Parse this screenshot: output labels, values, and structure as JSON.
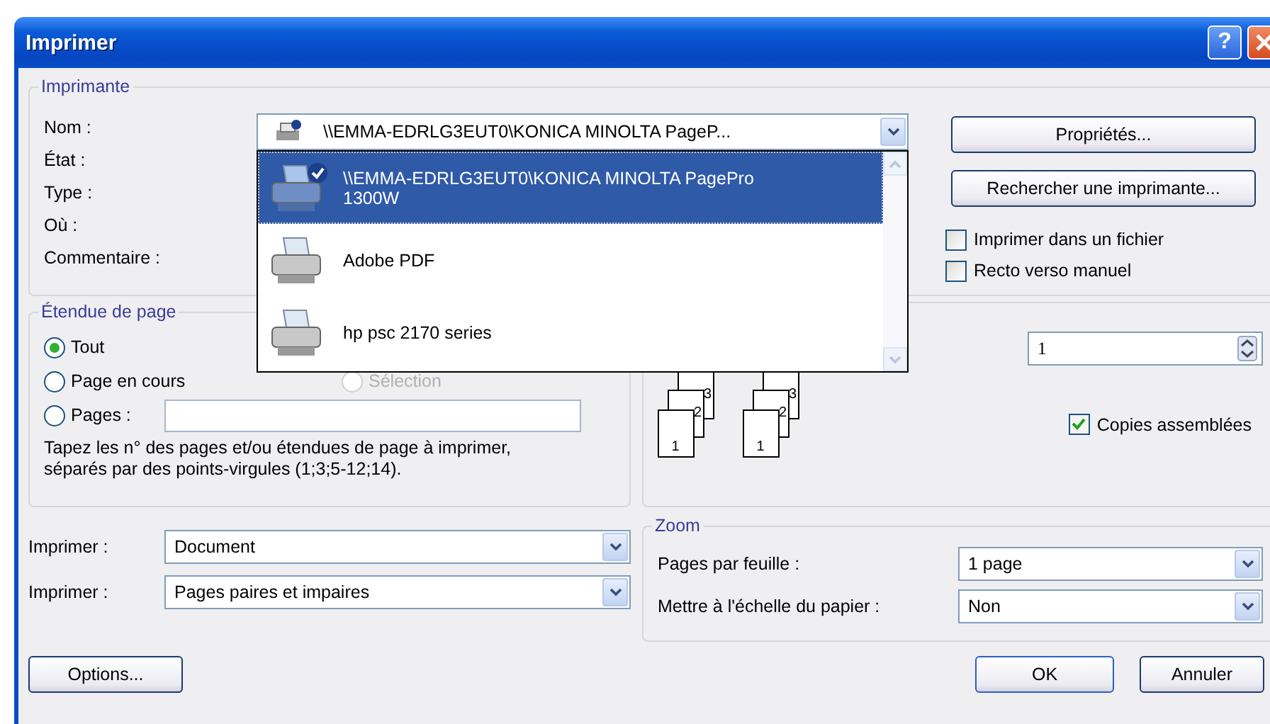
{
  "window": {
    "title": "Imprimer",
    "help_button": "?"
  },
  "printer": {
    "group_label": "Imprimante",
    "field_labels": [
      "Nom :",
      "État :",
      "Type :",
      "Où :",
      "Commentaire :"
    ],
    "name_combo": {
      "value": "\\\\EMMA-EDRLG3EUT0\\KONICA MINOLTA PageP...",
      "default": true
    },
    "dropdown": {
      "expanded": true,
      "items": [
        {
          "label": "\\\\EMMA-EDRLG3EUT0\\KONICA MINOLTA PagePro 1300W",
          "selected": true,
          "default": true
        },
        {
          "label": "Adobe PDF",
          "selected": false,
          "default": false
        },
        {
          "label": "hp psc 2170 series",
          "selected": false,
          "default": false
        }
      ]
    },
    "buttons": [
      "Propriétés...",
      "Rechercher une imprimante..."
    ],
    "checkboxes": [
      {
        "label": "Imprimer dans un fichier",
        "checked": false
      },
      {
        "label": "Recto verso manuel",
        "checked": false
      }
    ]
  },
  "page_range": {
    "group_label": "Étendue de page",
    "options": [
      {
        "label": "Tout",
        "selected": true,
        "disabled": false,
        "kind": "plain"
      },
      {
        "label": "Page en cours",
        "selected": false,
        "disabled": false,
        "kind": "plain"
      },
      {
        "label": "Sélection",
        "selected": false,
        "disabled": true,
        "kind": "plain"
      },
      {
        "label": "Pages :",
        "selected": false,
        "disabled": false,
        "kind": "range"
      }
    ],
    "hint": "Tapez les n° des pages et/ou étendues de page à imprimer, séparés par des points-virgules (1;3;5-12;14)."
  },
  "copies": {
    "count": "1",
    "stacks": [
      {
        "pages": [
          "3",
          "2",
          "1"
        ]
      },
      {
        "pages": [
          "3",
          "2",
          "1"
        ]
      }
    ],
    "collate": {
      "label": "Copies assemblées",
      "checked": true
    }
  },
  "print_rows": [
    {
      "label": "Imprimer :",
      "value": "Document"
    },
    {
      "label": "Imprimer :",
      "value": "Pages paires et impaires"
    }
  ],
  "zoom": {
    "group_label": "Zoom",
    "rows": [
      {
        "label": "Pages par feuille :",
        "value": "1 page"
      },
      {
        "label": "Mettre à l'échelle du papier :",
        "value": "Non"
      }
    ]
  },
  "footer": {
    "options_button": "Options...",
    "ok_button": "OK",
    "cancel_button": "Annuler"
  }
}
